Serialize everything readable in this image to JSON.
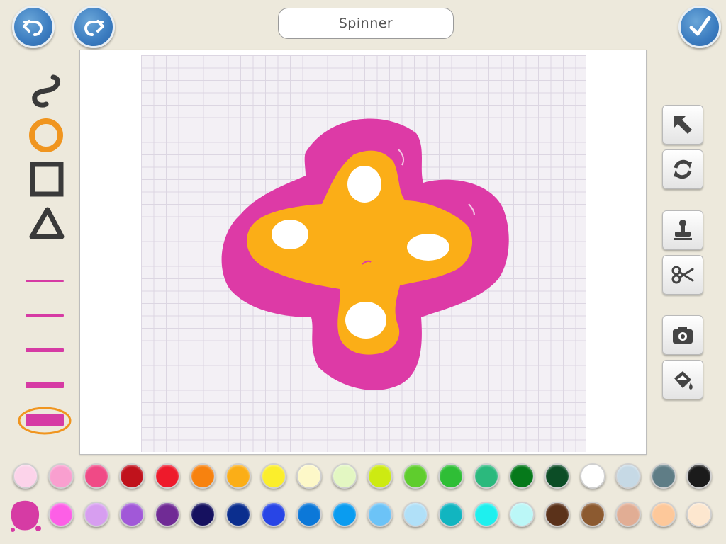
{
  "header": {
    "title": "Spinner",
    "undo_icon": "undo-arrow-icon",
    "redo_icon": "redo-arrow-icon",
    "done_icon": "checkmark-icon"
  },
  "left_tools": {
    "shapes": [
      "freehand-brush-icon",
      "circle-brush-icon",
      "square-brush-icon",
      "triangle-brush-icon"
    ],
    "selected_shape": "circle-brush-icon",
    "line_widths": [
      "thinnest",
      "thin",
      "medium",
      "thick",
      "thickest"
    ],
    "selected_line_width": "thickest"
  },
  "right_tools": [
    "select-arrow-icon",
    "rotate-icon",
    "stamp-icon",
    "scissors-icon",
    "camera-icon",
    "paint-bucket-icon"
  ],
  "palette": {
    "current_color": "#d63ba4",
    "row1": [
      "#fcd3ea",
      "#f99fcf",
      "#f04a86",
      "#c0121c",
      "#ee1a2b",
      "#f7820f",
      "#fbae17",
      "#fbee2c",
      "#fdf8c8",
      "#e3f7c2",
      "#cdea12",
      "#5fcd2d",
      "#2fbe36",
      "#2bb97d",
      "#06791b",
      "#0c4d26",
      "#ffffff",
      "#c6d9e5",
      "#5f7d86",
      "#1b1b1b"
    ],
    "row2": [
      "#fd5fe6",
      "#d79ef0",
      "#a158d8",
      "#702b95",
      "#16115f",
      "#0b2e8e",
      "#2845e6",
      "#0c78d8",
      "#0a9cf0",
      "#6cc3f7",
      "#b0e0f8",
      "#11b5c0",
      "#1ef0ee",
      "#bbf7f7",
      "#5b321a",
      "#8c5a30",
      "#e1ad94",
      "#fdc89a",
      "#fde7cf"
    ]
  }
}
